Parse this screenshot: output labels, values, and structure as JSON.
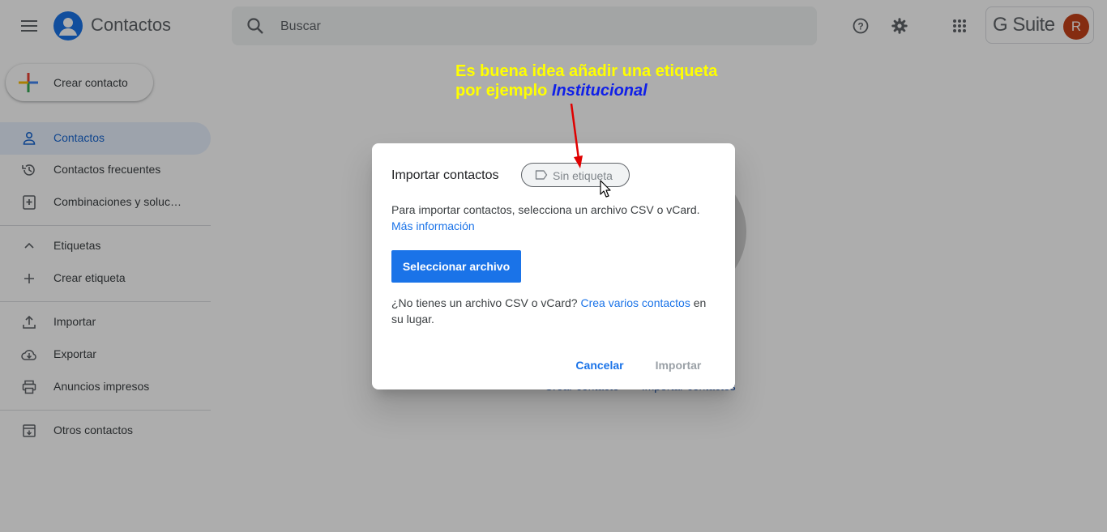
{
  "header": {
    "app_title": "Contactos",
    "search_placeholder": "Buscar",
    "brand_label": "G Suite",
    "avatar_initial": "R"
  },
  "sidebar": {
    "create_label": "Crear contacto",
    "items": [
      {
        "label": "Contactos",
        "icon": "person-icon",
        "active": true
      },
      {
        "label": "Contactos frecuentes",
        "icon": "history-icon"
      },
      {
        "label": "Combinaciones y soluc…",
        "icon": "merge-icon"
      },
      {
        "label": "Etiquetas",
        "icon": "chevron-up-icon"
      },
      {
        "label": "Crear etiqueta",
        "icon": "plus-icon"
      },
      {
        "label": "Importar",
        "icon": "upload-icon"
      },
      {
        "label": "Exportar",
        "icon": "cloud-download-icon"
      },
      {
        "label": "Anuncios impresos",
        "icon": "print-icon"
      },
      {
        "label": "Otros contactos",
        "icon": "archive-icon"
      }
    ]
  },
  "background": {
    "create_contact_link": "Crear contacto",
    "import_contacts_link": "Importar contactos"
  },
  "dialog": {
    "title": "Importar contactos",
    "label_chip": "Sin etiqueta",
    "description": "Para importar contactos, selecciona un archivo CSV o vCard.",
    "more_info_link": "Más información",
    "select_file_button": "Seleccionar archivo",
    "no_file_text": "¿No tienes un archivo CSV o vCard?",
    "create_multiple_link": "Crea varios contactos",
    "no_file_suffix": "en su lugar.",
    "cancel_button": "Cancelar",
    "import_button": "Importar"
  },
  "annotation": {
    "line1": "Es buena idea añadir una etiqueta",
    "line2_prefix": "por ejemplo",
    "line2_emphasis": "Institucional"
  },
  "colors": {
    "accent": "#1a73e8",
    "annotation": "#ffff00",
    "annotation_emphasis": "#1020e8",
    "arrow": "#e00000",
    "avatar": "#c5421a"
  }
}
